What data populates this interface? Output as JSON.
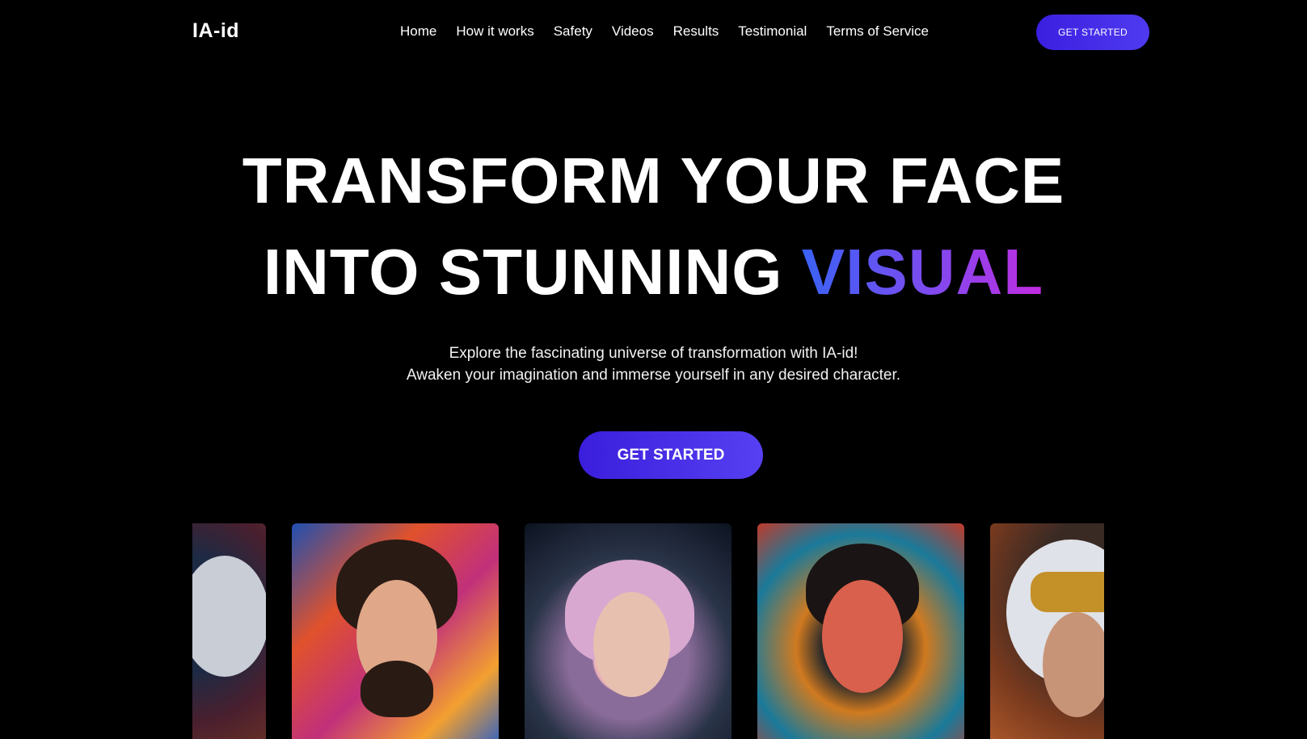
{
  "header": {
    "logo": "IA-id",
    "nav": [
      "Home",
      "How it works",
      "Safety",
      "Videos",
      "Results",
      "Testimonial",
      "Terms of Service"
    ],
    "cta_label": "GET STARTED"
  },
  "hero": {
    "title_line1": "TRANSFORM YOUR FACE",
    "title_line2_plain": "INTO STUNNING ",
    "title_line2_accent": "VISUAL",
    "subtitle_line1": "Explore the fascinating universe of transformation with IA-id!",
    "subtitle_line2": "Awaken your imagination and immerse yourself in any desired character.",
    "cta_label": "GET STARTED"
  },
  "gallery": {
    "items": [
      "astronaut-portrait",
      "abstract-painted-man-portrait",
      "pink-hair-woman-portrait",
      "floral-woman-portrait",
      "astronaut-portrait"
    ]
  },
  "colors": {
    "background": "#000000",
    "button_gradient_start": "#3a1edc",
    "button_gradient_end": "#5640f2",
    "accent_gradient": [
      "#3a62f5",
      "#7a4cf0",
      "#c22ce0"
    ]
  }
}
